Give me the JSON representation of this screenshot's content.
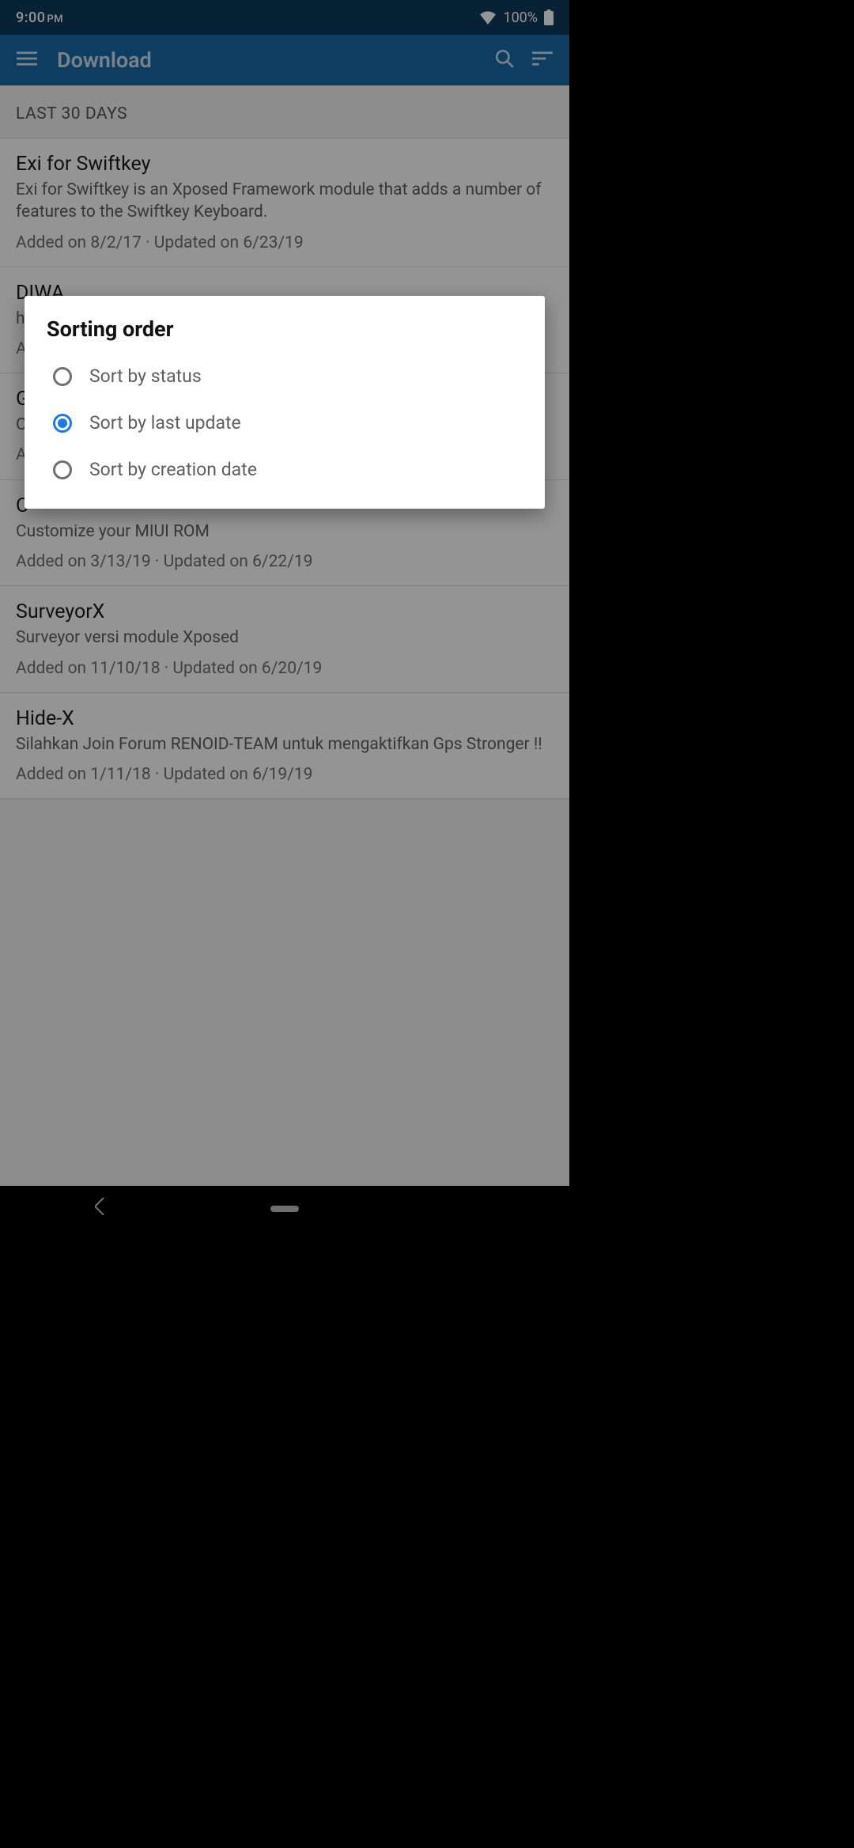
{
  "status": {
    "time": "9:00",
    "ampm": "PM",
    "battery": "100%"
  },
  "appbar": {
    "title": "Download"
  },
  "section_header": "LAST 30 DAYS",
  "items": [
    {
      "title": "Exi for Swiftkey",
      "desc": "Exi for Swiftkey is an Xposed Framework module that adds a number of features to the Swiftkey Keyboard.",
      "meta": "Added on 8/2/17 · Updated on 6/23/19"
    },
    {
      "title": "DIWA",
      "desc": "hide root hide mock hide fa hide xposed gps acc autobid u",
      "meta": "A"
    },
    {
      "title": "G",
      "desc": "C b",
      "meta": "A"
    },
    {
      "title": "C",
      "desc": "Customize your MIUI ROM",
      "meta": "Added on 3/13/19 · Updated on 6/22/19"
    },
    {
      "title": "SurveyorX",
      "desc": "Surveyor versi module Xposed",
      "meta": "Added on 11/10/18 · Updated on 6/20/19"
    },
    {
      "title": "Hide-X",
      "desc": "Silahkan Join Forum RENOID-TEAM untuk mengaktifkan Gps Stronger !!",
      "meta": "Added on 1/11/18 · Updated on 6/19/19"
    }
  ],
  "dialog": {
    "title": "Sorting order",
    "options": [
      {
        "label": "Sort by status",
        "selected": false
      },
      {
        "label": "Sort by last update",
        "selected": true
      },
      {
        "label": "Sort by creation date",
        "selected": false
      }
    ]
  }
}
